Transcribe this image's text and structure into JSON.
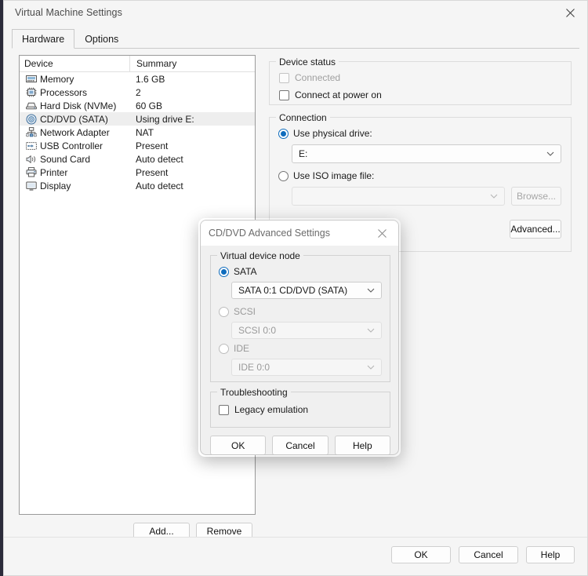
{
  "window": {
    "title": "Virtual Machine Settings",
    "close_icon": "close-icon"
  },
  "tabs": [
    {
      "label": "Hardware",
      "active": true
    },
    {
      "label": "Options",
      "active": false
    }
  ],
  "device_list": {
    "columns": [
      "Device",
      "Summary"
    ],
    "rows": [
      {
        "icon": "memory-icon",
        "name": "Memory",
        "summary": "1.6 GB",
        "selected": false
      },
      {
        "icon": "processor-icon",
        "name": "Processors",
        "summary": "2",
        "selected": false
      },
      {
        "icon": "harddisk-icon",
        "name": "Hard Disk (NVMe)",
        "summary": "60 GB",
        "selected": false
      },
      {
        "icon": "cddvd-icon",
        "name": "CD/DVD (SATA)",
        "summary": "Using drive E:",
        "selected": true
      },
      {
        "icon": "network-icon",
        "name": "Network Adapter",
        "summary": "NAT",
        "selected": false
      },
      {
        "icon": "usb-icon",
        "name": "USB Controller",
        "summary": "Present",
        "selected": false
      },
      {
        "icon": "soundcard-icon",
        "name": "Sound Card",
        "summary": "Auto detect",
        "selected": false
      },
      {
        "icon": "printer-icon",
        "name": "Printer",
        "summary": "Present",
        "selected": false
      },
      {
        "icon": "display-icon",
        "name": "Display",
        "summary": "Auto detect",
        "selected": false
      }
    ]
  },
  "list_buttons": {
    "add": "Add...",
    "remove": "Remove"
  },
  "device_status": {
    "title": "Device status",
    "connected": {
      "label": "Connected",
      "checked": false,
      "disabled": true
    },
    "connect_at_power_on": {
      "label": "Connect at power on",
      "checked": false,
      "disabled": false
    }
  },
  "connection": {
    "title": "Connection",
    "use_physical_drive": {
      "label": "Use physical drive:",
      "selected": true
    },
    "physical_drive_value": "E:",
    "use_iso": {
      "label": "Use ISO image file:",
      "selected": false
    },
    "iso_value": "",
    "browse": "Browse...",
    "advanced": "Advanced..."
  },
  "footer": {
    "ok": "OK",
    "cancel": "Cancel",
    "help": "Help"
  },
  "modal": {
    "title": "CD/DVD Advanced Settings",
    "close_icon": "close-icon",
    "virtual_device_node": {
      "title": "Virtual device node",
      "sata": {
        "label": "SATA",
        "selected": true,
        "value": "SATA 0:1  CD/DVD (SATA)"
      },
      "scsi": {
        "label": "SCSI",
        "selected": false,
        "value": "SCSI 0:0",
        "disabled": true
      },
      "ide": {
        "label": "IDE",
        "selected": false,
        "value": "IDE 0:0",
        "disabled": true
      }
    },
    "troubleshooting": {
      "title": "Troubleshooting",
      "legacy_emulation": {
        "label": "Legacy emulation",
        "checked": false
      }
    },
    "buttons": {
      "ok": "OK",
      "cancel": "Cancel",
      "help": "Help"
    }
  },
  "colors": {
    "accent": "#0f6cbd",
    "selection": "#eeeeee",
    "window_bg": "#f5f5f5"
  }
}
